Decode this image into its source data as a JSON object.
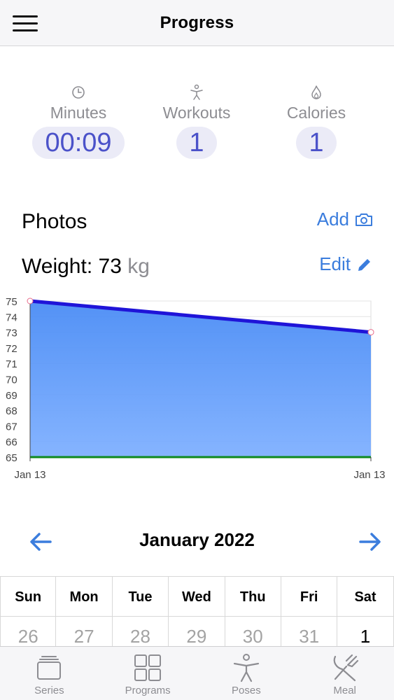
{
  "header": {
    "title": "Progress",
    "menu_icon": "hamburger-menu-icon"
  },
  "stats": [
    {
      "icon": "clock-icon",
      "label": "Minutes",
      "value": "00:09"
    },
    {
      "icon": "person-pose-icon",
      "label": "Workouts",
      "value": "1"
    },
    {
      "icon": "flame-icon",
      "label": "Calories",
      "value": "1"
    }
  ],
  "photos": {
    "title": "Photos",
    "action_label": "Add",
    "action_icon": "camera-icon"
  },
  "weight": {
    "prefix": "Weight:",
    "value": "73",
    "unit": "kg",
    "action_label": "Edit",
    "action_icon": "pencil-icon"
  },
  "chart_data": {
    "type": "area",
    "x": [
      "Jan 13",
      "Jan 13"
    ],
    "series": [
      {
        "values": [
          75,
          73
        ],
        "color": "#1f14d8",
        "fill": "#5a98ff"
      }
    ],
    "baseline": 65,
    "baseline_color": "#0e8a1e",
    "ylim": [
      65,
      75
    ],
    "yticks": [
      75,
      74,
      73,
      72,
      71,
      70,
      69,
      68,
      67,
      66,
      65
    ],
    "grid": true
  },
  "calendar": {
    "month_label": "January 2022",
    "prev_icon": "arrow-left-icon",
    "next_icon": "arrow-right-icon",
    "weekdays": [
      "Sun",
      "Mon",
      "Tue",
      "Wed",
      "Thu",
      "Fri",
      "Sat"
    ],
    "first_week": [
      {
        "day": "26",
        "current": false
      },
      {
        "day": "27",
        "current": false
      },
      {
        "day": "28",
        "current": false
      },
      {
        "day": "29",
        "current": false
      },
      {
        "day": "30",
        "current": false
      },
      {
        "day": "31",
        "current": false
      },
      {
        "day": "1",
        "current": true
      }
    ]
  },
  "tabbar": [
    {
      "label": "Series",
      "icon": "stack-icon"
    },
    {
      "label": "Programs",
      "icon": "grid-icon"
    },
    {
      "label": "Poses",
      "icon": "person-pose-icon"
    },
    {
      "label": "Meal",
      "icon": "fork-knife-icon"
    }
  ],
  "colors": {
    "accent": "#3b7ddd",
    "pill_bg": "#ebebf7",
    "pill_text": "#4b52c9"
  }
}
